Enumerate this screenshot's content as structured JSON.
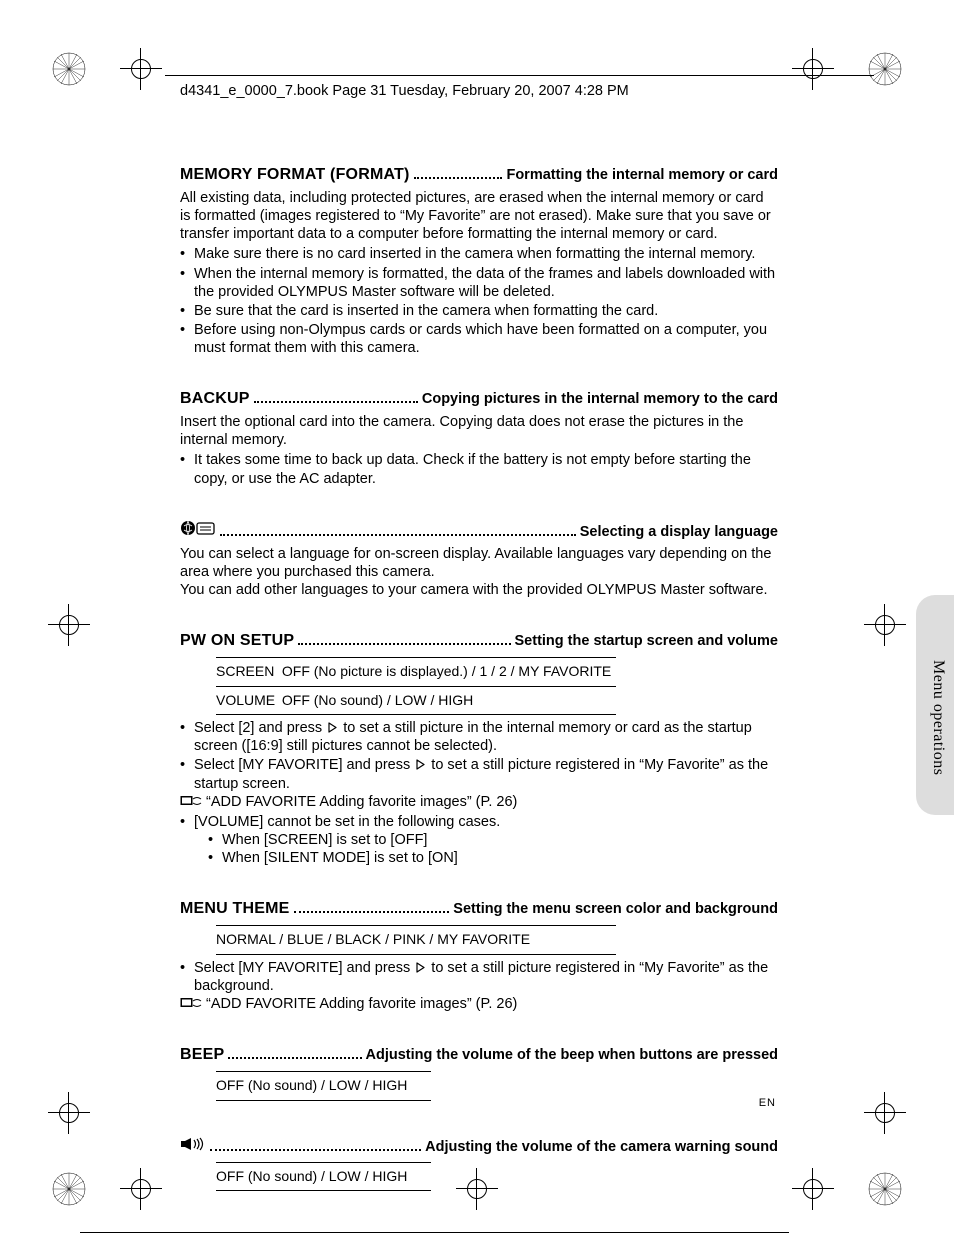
{
  "header": {
    "line": "d4341_e_0000_7.book  Page 31  Tuesday, February 20, 2007  4:28 PM"
  },
  "sections": {
    "memory_format": {
      "title": "MEMORY FORMAT (FORMAT)",
      "subtitle": "Formatting the internal memory or card",
      "para": "All existing data, including protected pictures, are erased when the internal memory or card is formatted (images registered to “My Favorite” are not erased). Make sure that you save or transfer important data to a computer before formatting the internal memory or card.",
      "bullets": [
        "Make sure there is no card inserted in the camera when formatting the internal memory.",
        "When the internal memory is formatted, the data of the frames and labels downloaded with the provided OLYMPUS Master software will be deleted.",
        "Be sure that the card is inserted in the camera when formatting the card.",
        "Before using non-Olympus cards or cards which have been formatted on a computer, you must format them with this camera."
      ]
    },
    "backup": {
      "title": "BACKUP",
      "subtitle": "Copying pictures in the internal memory to the card",
      "para": "Insert the optional card into the camera. Copying data does not erase the pictures in the internal memory.",
      "bullets": [
        "It takes some time to back up data. Check if the battery is not empty before starting the copy, or use the AC adapter."
      ]
    },
    "language": {
      "subtitle": "Selecting a display language",
      "para1": "You can select a language for on-screen display. Available languages vary depending on the area where you purchased this camera.",
      "para2": "You can add other languages to your camera with the provided OLYMPUS Master software."
    },
    "pw_on": {
      "title": "PW ON SETUP",
      "subtitle": "Setting the startup screen and volume",
      "row1_label": "SCREEN",
      "row1_opts": "OFF (No picture is displayed.) /   1   /   2   / MY FAVORITE",
      "row2_label": "VOLUME",
      "row2_opts": "OFF (No sound) /     LOW    / HIGH",
      "b1a": "Select [2] and press ",
      "b1b": " to set a still picture in the internal memory or card as the startup screen ([16:9] still pictures cannot be selected).",
      "b2a": "Select [MY FAVORITE] and press ",
      "b2b": " to set a still picture registered in “My Favorite” as the startup screen.",
      "ref": "“ADD FAVORITE Adding favorite images” (P. 26)",
      "b3": "[VOLUME] cannot be set in the following cases.",
      "b3s1": "When [SCREEN] is set to [OFF]",
      "b3s2": "When [SILENT MODE] is set to [ON]"
    },
    "menu_theme": {
      "title": "MENU THEME",
      "subtitle": "Setting the menu screen color and background",
      "opts": "NORMAL    / BLUE     / BLACK  / PINK     / MY FAVORITE",
      "b1a": "Select [MY FAVORITE] and press ",
      "b1b": " to set a still picture registered in “My Favorite” as the background.",
      "ref": "“ADD FAVORITE Adding favorite images” (P. 26)"
    },
    "beep": {
      "title": "BEEP",
      "subtitle": "Adjusting the volume of the beep when buttons are pressed",
      "opts": "OFF (No sound) / LOW      / HIGH"
    },
    "warning": {
      "subtitle": "Adjusting the volume of the camera warning sound",
      "opts": "OFF (No sound) / LOW      / HIGH"
    }
  },
  "side_label": "Menu operations",
  "footer": {
    "lang": "EN"
  }
}
